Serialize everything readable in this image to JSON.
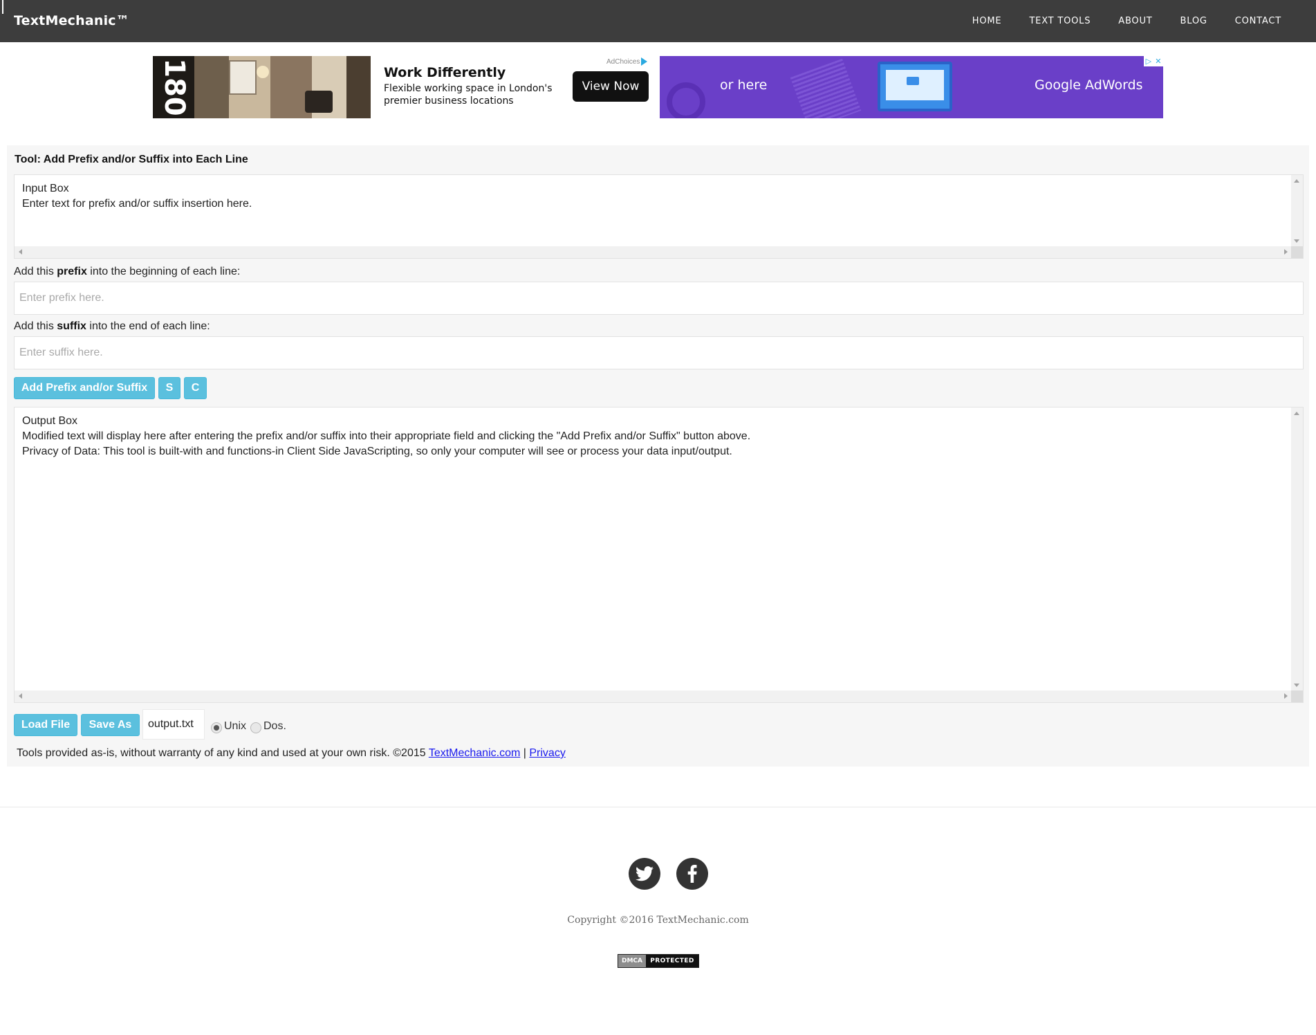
{
  "nav": {
    "brand": "TextMechanic™",
    "links": [
      "HOME",
      "TEXT TOOLS",
      "ABOUT",
      "BLOG",
      "CONTACT"
    ]
  },
  "ad": {
    "brand_mark": "180",
    "headline": "Work Differently",
    "subtext": "Flexible working space in London's premier business locations",
    "button": "View Now",
    "adchoices": "AdChoices",
    "secondary_text": "or here",
    "secondary_brand": "Google AdWords",
    "accent_color": "#6a3fc8"
  },
  "tool": {
    "title": "Tool: Add Prefix and/or Suffix into Each Line",
    "input_box": "Input Box\nEnter text for prefix and/or suffix insertion here.",
    "prefix_label_pre": "Add this ",
    "prefix_label_bold": "prefix",
    "prefix_label_post": " into the beginning of each line:",
    "prefix_placeholder": "Enter prefix here.",
    "suffix_label_pre": "Add this ",
    "suffix_label_bold": "suffix",
    "suffix_label_post": " into the end of each line:",
    "suffix_placeholder": "Enter suffix here.",
    "buttons": {
      "add": "Add Prefix and/or Suffix",
      "s": "S",
      "c": "C",
      "load": "Load File",
      "save": "Save As"
    },
    "output_box": "Output Box\nModified text will display here after entering the prefix and/or suffix into their appropriate field and clicking the \"Add Prefix and/or Suffix\" button above.\nPrivacy of Data: This tool is built-with and functions-in Client Side JavaScripting, so only your computer will see or process your data input/output.",
    "filename": "output.txt",
    "line_endings": [
      {
        "label": "Unix",
        "checked": true
      },
      {
        "label": "Dos.",
        "checked": false
      }
    ],
    "button_color": "#5bc0de"
  },
  "disclaimer": {
    "text": "Tools provided as-is, without warranty of any kind and used at your own risk. ©2015 ",
    "site_link": "TextMechanic.com",
    "separator": " | ",
    "privacy_link": "Privacy"
  },
  "footer": {
    "social": [
      "twitter-icon",
      "facebook-icon"
    ],
    "copyright": "Copyright ©2016 TextMechanic.com",
    "dmca_left": "DMCA",
    "dmca_right": "PROTECTED"
  }
}
